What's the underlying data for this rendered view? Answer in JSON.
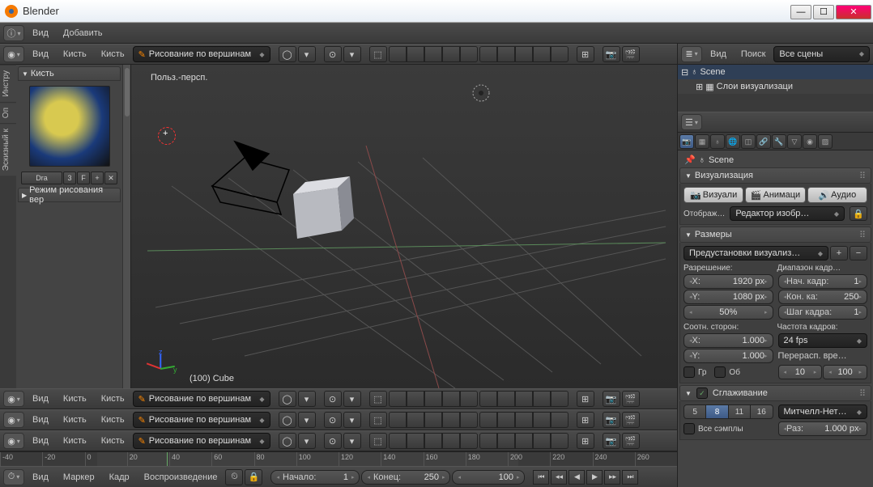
{
  "window": {
    "title": "Blender"
  },
  "info_menu": {
    "view": "Вид",
    "add": "Добавить"
  },
  "view3d_header": {
    "menu_view": "Вид",
    "menu_brush": "Кисть",
    "menu_brushes": "Кисть",
    "mode": "Рисование по вершинам"
  },
  "toolshelf": {
    "tabs": {
      "tools": "Инстру",
      "options": "Оп",
      "grease": "Эскизный к"
    },
    "panel_brush": "Кисть",
    "mini": {
      "dra": "Dra",
      "three": "3",
      "f": "F"
    },
    "panel_paint_mode": "Режим рисования вер"
  },
  "viewport": {
    "persp_label": "Польз.-персп.",
    "object_label": "(100) Cube"
  },
  "timeline": {
    "ticks": [
      "-40",
      "-20",
      "0",
      "20",
      "40",
      "60",
      "80",
      "100",
      "120",
      "140",
      "160",
      "180",
      "200",
      "220",
      "240",
      "260"
    ],
    "menu_view": "Вид",
    "menu_marker": "Маркер",
    "menu_frame": "Кадр",
    "menu_playback": "Воспроизведение",
    "start_lbl": "Начало:",
    "start_val": "1",
    "end_lbl": "Конец:",
    "end_val": "250",
    "cur_val": "100"
  },
  "outliner": {
    "menu_view": "Вид",
    "menu_search": "Поиск",
    "scene_dd": "Все сцены",
    "row_scene": "Scene",
    "row_layers": "Слои визуализаци"
  },
  "props": {
    "crumb": "Scene",
    "panel_render": "Визуализация",
    "btn_render": "Визуали",
    "btn_anim": "Анимаци",
    "btn_audio": "Аудио",
    "display_lbl": "Отображ…",
    "display_dd": "Редактор изобр…",
    "panel_dim": "Размеры",
    "presets_dd": "Предустановки визуализ…",
    "res_lbl": "Разрешение:",
    "frange_lbl": "Диапазон кадр…",
    "res_x": "X:",
    "res_x_v": "1920 px",
    "res_y": "Y:",
    "res_y_v": "1080 px",
    "res_pct": "50%",
    "fr_start": "Нач. кадр:",
    "fr_start_v": "1",
    "fr_end": "Кон. ка:",
    "fr_end_v": "250",
    "fr_step": "Шаг кадра:",
    "fr_step_v": "1",
    "aspect_lbl": "Соотн. сторон:",
    "fps_lbl": "Частота кадров:",
    "asp_x": "X:",
    "asp_x_v": "1.000",
    "asp_y": "Y:",
    "asp_y_v": "1.000",
    "fps_dd": "24 fps",
    "remap_lbl": "Перерасп. вре…",
    "border": "Гр",
    "crop": "Об",
    "old": "10",
    "new": "100",
    "panel_aa": "Сглаживание",
    "aa5": "5",
    "aa8": "8",
    "aa11": "11",
    "aa16": "16",
    "aa_dd": "Митчелл-Нет…",
    "full_sample": "Все сэмплы",
    "size_lbl": "Раз:",
    "size_v": "1.000 px"
  }
}
